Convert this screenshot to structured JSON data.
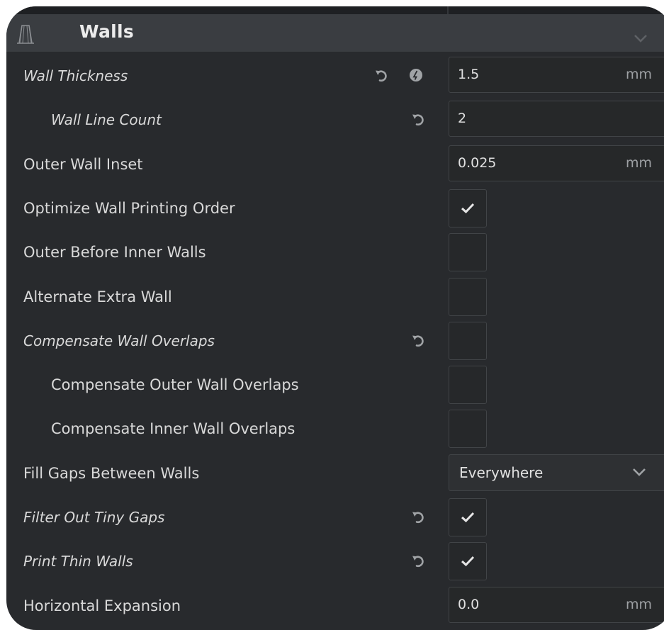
{
  "section": {
    "title": "Walls",
    "icon": "walls-icon",
    "chevron_icon": "chevron-down-icon"
  },
  "settings": [
    {
      "id": "wall-thickness",
      "label": "Wall Thickness",
      "italic": true,
      "indent": false,
      "reset": true,
      "calc": true,
      "control": "number",
      "value": "1.5",
      "unit": "mm"
    },
    {
      "id": "wall-line-count",
      "label": "Wall Line Count",
      "italic": true,
      "indent": true,
      "reset": true,
      "calc": false,
      "control": "number",
      "value": "2",
      "unit": ""
    },
    {
      "id": "outer-wall-inset",
      "label": "Outer Wall Inset",
      "italic": false,
      "indent": false,
      "reset": false,
      "calc": false,
      "control": "number",
      "value": "0.025",
      "unit": "mm"
    },
    {
      "id": "optimize-wall-printing-order",
      "label": "Optimize Wall Printing Order",
      "italic": false,
      "indent": false,
      "reset": false,
      "calc": false,
      "control": "checkbox",
      "checked": true
    },
    {
      "id": "outer-before-inner-walls",
      "label": "Outer Before Inner Walls",
      "italic": false,
      "indent": false,
      "reset": false,
      "calc": false,
      "control": "checkbox",
      "checked": false
    },
    {
      "id": "alternate-extra-wall",
      "label": "Alternate Extra Wall",
      "italic": false,
      "indent": false,
      "reset": false,
      "calc": false,
      "control": "checkbox",
      "checked": false
    },
    {
      "id": "compensate-wall-overlaps",
      "label": "Compensate Wall Overlaps",
      "italic": true,
      "indent": false,
      "reset": true,
      "calc": false,
      "control": "checkbox",
      "checked": false
    },
    {
      "id": "compensate-outer-wall-overlaps",
      "label": "Compensate Outer Wall Overlaps",
      "italic": false,
      "indent": true,
      "reset": false,
      "calc": false,
      "control": "checkbox",
      "checked": false
    },
    {
      "id": "compensate-inner-wall-overlaps",
      "label": "Compensate Inner Wall Overlaps",
      "italic": false,
      "indent": true,
      "reset": false,
      "calc": false,
      "control": "checkbox",
      "checked": false
    },
    {
      "id": "fill-gaps-between-walls",
      "label": "Fill Gaps Between Walls",
      "italic": false,
      "indent": false,
      "reset": false,
      "calc": false,
      "control": "select",
      "value": "Everywhere"
    },
    {
      "id": "filter-out-tiny-gaps",
      "label": "Filter Out Tiny Gaps",
      "italic": true,
      "indent": false,
      "reset": true,
      "calc": false,
      "control": "checkbox",
      "checked": true
    },
    {
      "id": "print-thin-walls",
      "label": "Print Thin Walls",
      "italic": true,
      "indent": false,
      "reset": true,
      "calc": false,
      "control": "checkbox",
      "checked": true
    },
    {
      "id": "horizontal-expansion",
      "label": "Horizontal Expansion",
      "italic": false,
      "indent": false,
      "reset": false,
      "calc": false,
      "control": "number",
      "value": "0.0",
      "unit": "mm"
    }
  ],
  "icons": {
    "reset": "reset-icon",
    "calculated": "calculated-value-icon",
    "check": "check-icon"
  },
  "colors": {
    "panel_bg": "#282a2d",
    "header_bg": "#3a3d41",
    "field_bg": "#262829",
    "field_border": "#414447",
    "text": "#d9d9d9",
    "muted_text": "#9ea1a4",
    "icon": "#a0a3a6"
  }
}
